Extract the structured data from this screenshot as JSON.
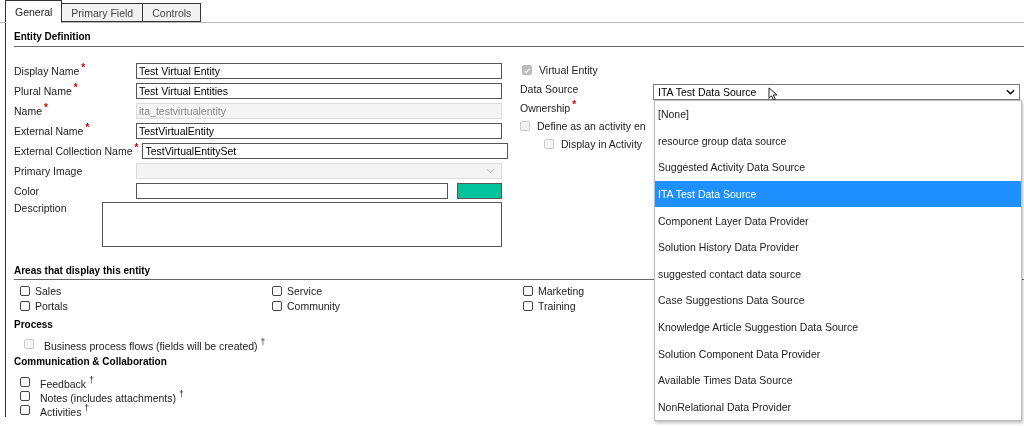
{
  "tabs": [
    {
      "label": "General",
      "selected": true
    },
    {
      "label": "Primary Field",
      "selected": false
    },
    {
      "label": "Controls",
      "selected": false
    }
  ],
  "entity_definition": {
    "title": "Entity Definition",
    "fields": [
      {
        "kind": "text",
        "label": "Display Name",
        "required_mark": "*",
        "value": "Test Virtual Entity",
        "disabled": false
      },
      {
        "kind": "text",
        "label": "Plural Name",
        "required_mark": "*",
        "value": "Test Virtual Entities",
        "disabled": false
      },
      {
        "kind": "text",
        "label": "Name",
        "required_mark": "*",
        "value": "ita_testvirtualentity",
        "disabled": true
      },
      {
        "kind": "text",
        "label": "External Name",
        "required_mark": "*",
        "value": "TestVirtualEntity",
        "disabled": false
      },
      {
        "kind": "text",
        "label": "External Collection Name",
        "required_mark": "*",
        "value": "TestVirtualEntitySet",
        "disabled": false
      },
      {
        "kind": "select",
        "label": "Primary Image",
        "disabled": true
      },
      {
        "kind": "color",
        "label": "Color",
        "color": "#00c59c"
      },
      {
        "kind": "textarea",
        "label": "Description"
      }
    ],
    "virtual_entity": {
      "label": "Virtual Entity",
      "checked": true,
      "disabled": true
    },
    "data_source": {
      "label": "Data Source",
      "value": "ITA Test Data Source",
      "options": [
        {
          "label": "[None]",
          "selected": false
        },
        {
          "label": "resource group data source",
          "selected": false
        },
        {
          "label": "Suggested Activity Data Source",
          "selected": false
        },
        {
          "label": "ITA Test Data Source",
          "selected": true
        },
        {
          "label": "Component Layer Data Provider",
          "selected": false
        },
        {
          "label": "Solution History Data Provider",
          "selected": false
        },
        {
          "label": "suggested contact data source",
          "selected": false
        },
        {
          "label": "Case Suggestions Data Source",
          "selected": false
        },
        {
          "label": "Knowledge Article Suggestion Data Source",
          "selected": false
        },
        {
          "label": "Solution Component Data Provider",
          "selected": false
        },
        {
          "label": "Available Times Data Source",
          "selected": false
        },
        {
          "label": "NonRelational Data Provider",
          "selected": false
        }
      ]
    },
    "ownership": {
      "label": "Ownership",
      "required_mark": "*"
    },
    "activity_options": [
      {
        "label": "Define as an activity en",
        "checked": false,
        "disabled": true,
        "children": [
          {
            "label": "Display in Activity",
            "checked": false,
            "disabled": true
          }
        ]
      }
    ]
  },
  "areas": {
    "title": "Areas that display this entity",
    "items": [
      {
        "label": "Sales",
        "checked": false
      },
      {
        "label": "Service",
        "checked": false
      },
      {
        "label": "Marketing",
        "checked": false
      },
      {
        "label": "Portals",
        "checked": false
      },
      {
        "label": "Community",
        "checked": false
      },
      {
        "label": "Training",
        "checked": false
      }
    ]
  },
  "process": {
    "title": "Process",
    "items": [
      {
        "label": "Business process flows (fields will be created) $^{†}$",
        "checked": false,
        "disabled": true
      }
    ]
  },
  "communication": {
    "title": "Communication & Collaboration",
    "items": [
      {
        "label": "Feedback $^{†}$",
        "checked": false,
        "disabled": false
      },
      {
        "label": "Notes (includes attachments) $^{†}$",
        "checked": false,
        "disabled": false
      },
      {
        "label": "Activities $^{†}$",
        "checked": false,
        "disabled": false
      }
    ]
  }
}
